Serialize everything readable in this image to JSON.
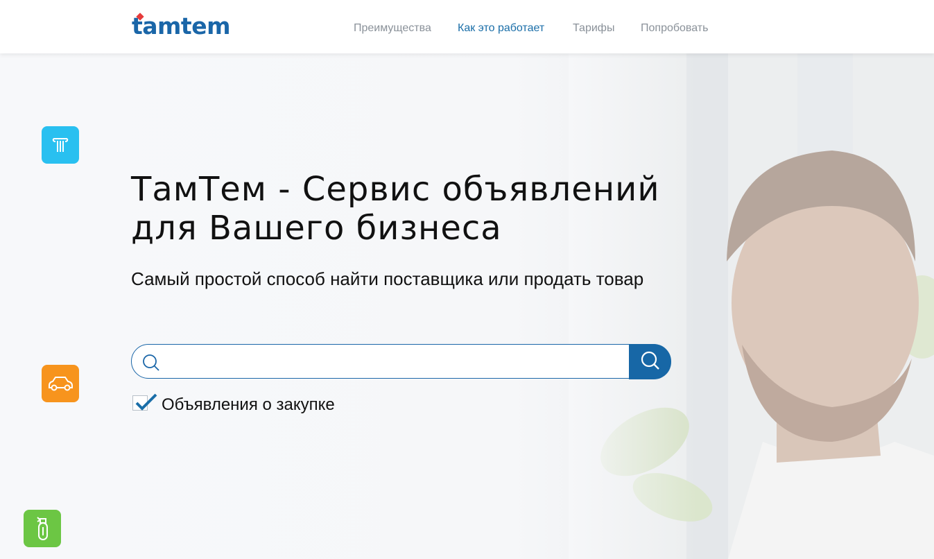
{
  "brand": {
    "logo_text": "tamtem",
    "accent": "#1a66a8",
    "logo_dot_color": "#e63b3b"
  },
  "nav": {
    "items": [
      {
        "label": "Преимущества",
        "active": false
      },
      {
        "label": "Как это работает",
        "active": true
      },
      {
        "label": "Тарифы",
        "active": false
      },
      {
        "label": "Попробовать",
        "active": false
      }
    ]
  },
  "hero": {
    "title_line1": "ТамТем - Сервис объявлений",
    "title_line2": "для Вашего бизнеса",
    "subtitle": "Самый простой способ найти поставщика или продать товар"
  },
  "search": {
    "value": "",
    "placeholder": "",
    "button_icon": "search-icon",
    "inner_icon": "search-icon"
  },
  "filter": {
    "checked": true,
    "label": "Объявления о закупке"
  },
  "side_icons": [
    {
      "name": "building-columns-icon",
      "color": "#29c0f0"
    },
    {
      "name": "car-icon",
      "color": "#f7941d"
    },
    {
      "name": "spray-bottle-icon",
      "color": "#6cc644"
    }
  ]
}
